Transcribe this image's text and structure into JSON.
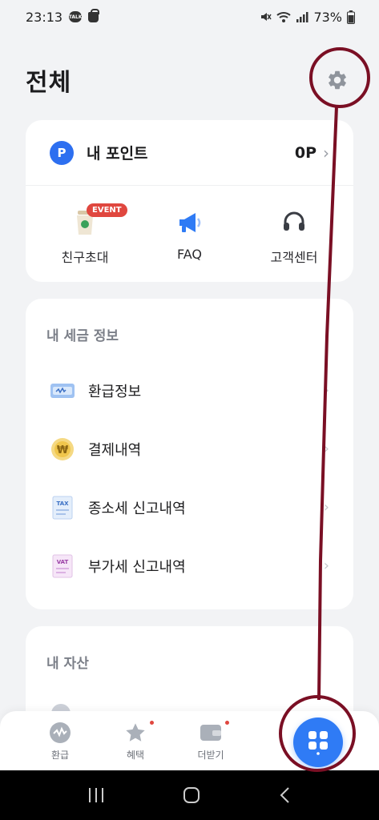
{
  "status_bar": {
    "time": "23:13",
    "battery": "73%"
  },
  "header": {
    "title": "전체"
  },
  "points": {
    "label": "내 포인트",
    "value": "0P"
  },
  "quick_actions": [
    {
      "label": "친구초대",
      "badge": "EVENT",
      "icon": "coffee-cup-icon"
    },
    {
      "label": "FAQ",
      "icon": "megaphone-icon"
    },
    {
      "label": "고객센터",
      "icon": "headset-icon"
    }
  ],
  "tax_section": {
    "title": "내 세금 정보",
    "items": [
      {
        "label": "환급정보",
        "icon": "refund-card-icon"
      },
      {
        "label": "결제내역",
        "icon": "won-coin-icon"
      },
      {
        "label": "종소세 신고내역",
        "icon": "tax-document-icon",
        "icon_text": "TAX"
      },
      {
        "label": "부가세 신고내역",
        "icon": "vat-document-icon",
        "icon_text": "VAT"
      }
    ]
  },
  "assets_section": {
    "title": "내 자산"
  },
  "bottom_nav": [
    {
      "label": "환급",
      "icon": "refund-icon"
    },
    {
      "label": "혜택",
      "icon": "star-icon",
      "dot": true
    },
    {
      "label": "더받기",
      "icon": "wallet-icon",
      "dot": true
    }
  ],
  "colors": {
    "accent": "#2f7bf5",
    "badge_red": "#e0473f",
    "annotation": "#7a0f24"
  }
}
